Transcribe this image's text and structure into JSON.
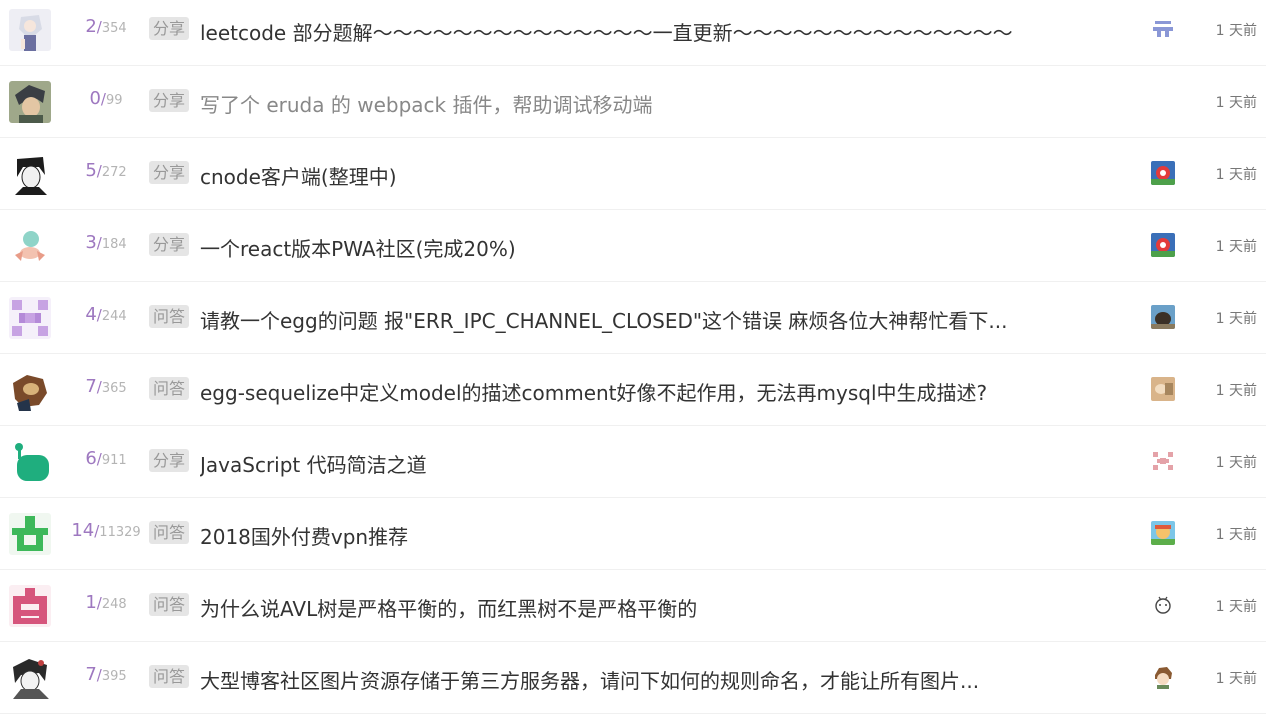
{
  "topics": [
    {
      "reply_count": "2",
      "separator": "/",
      "visit_count": "354",
      "tab": "分享",
      "title": "leetcode 部分题解～～～～～～～～～～～～～～一直更新～～～～～～～～～～～～～～",
      "last_reply_time": "1 天前",
      "author_avatar": "anime-girl-silver-hair",
      "last_reply_avatar": "pixel-avatar-blue"
    },
    {
      "reply_count": "0",
      "separator": "/",
      "visit_count": "99",
      "tab": "分享",
      "title": "写了个 eruda 的 webpack 插件，帮助调试移动端",
      "last_reply_time": "1 天前",
      "author_avatar": "anime-boy-dark-hair",
      "last_reply_avatar": ""
    },
    {
      "reply_count": "5",
      "separator": "/",
      "visit_count": "272",
      "tab": "分享",
      "title": "cnode客户端(整理中)",
      "last_reply_time": "1 天前",
      "author_avatar": "manga-boy-black-white",
      "last_reply_avatar": "cartoon-red-flower"
    },
    {
      "reply_count": "3",
      "separator": "/",
      "visit_count": "184",
      "tab": "分享",
      "title": "一个react版本PWA社区(完成20%)",
      "last_reply_time": "1 天前",
      "author_avatar": "cartoon-character-teal",
      "last_reply_avatar": "cartoon-red-flower"
    },
    {
      "reply_count": "4",
      "separator": "/",
      "visit_count": "244",
      "tab": "问答",
      "title": "请教一个egg的问题 报\"ERR_IPC_CHANNEL_CLOSED\"这个错误 麻烦各位大神帮忙看下...",
      "last_reply_time": "1 天前",
      "author_avatar": "identicon-purple",
      "last_reply_avatar": "photo-dark-figure"
    },
    {
      "reply_count": "7",
      "separator": "/",
      "visit_count": "365",
      "tab": "问答",
      "title": "egg-sequelize中定义model的描述comment好像不起作用，无法再mysql中生成描述?",
      "last_reply_time": "1 天前",
      "author_avatar": "photo-dog",
      "last_reply_avatar": "photo-tan"
    },
    {
      "reply_count": "6",
      "separator": "/",
      "visit_count": "911",
      "tab": "分享",
      "title": "JavaScript 代码简洁之道",
      "last_reply_time": "1 天前",
      "author_avatar": "green-blob",
      "last_reply_avatar": "identicon-pink"
    },
    {
      "reply_count": "14",
      "separator": "/",
      "visit_count": "11329",
      "tab": "问答",
      "title": "2018国外付费vpn推荐",
      "last_reply_time": "1 天前",
      "author_avatar": "identicon-green",
      "last_reply_avatar": "cartoon-colorful"
    },
    {
      "reply_count": "1",
      "separator": "/",
      "visit_count": "248",
      "tab": "问答",
      "title": "为什么说AVL树是严格平衡的，而红黑树不是严格平衡的",
      "last_reply_time": "1 天前",
      "author_avatar": "identicon-pink-large",
      "last_reply_avatar": "sketch-character"
    },
    {
      "reply_count": "7",
      "separator": "/",
      "visit_count": "395",
      "tab": "问答",
      "title": "大型博客社区图片资源存储于第三方服务器，请问下如何的规则命名，才能让所有图片...",
      "last_reply_time": "1 天前",
      "author_avatar": "manga-character-sketch",
      "last_reply_avatar": "cartoon-brown-hair"
    }
  ],
  "colors": {
    "reply_count": "#9e78c0",
    "visit_count": "#b4b4b4",
    "badge_bg": "#e5e5e5",
    "badge_text": "#999999",
    "title": "#333333",
    "title_visited": "#888888"
  }
}
